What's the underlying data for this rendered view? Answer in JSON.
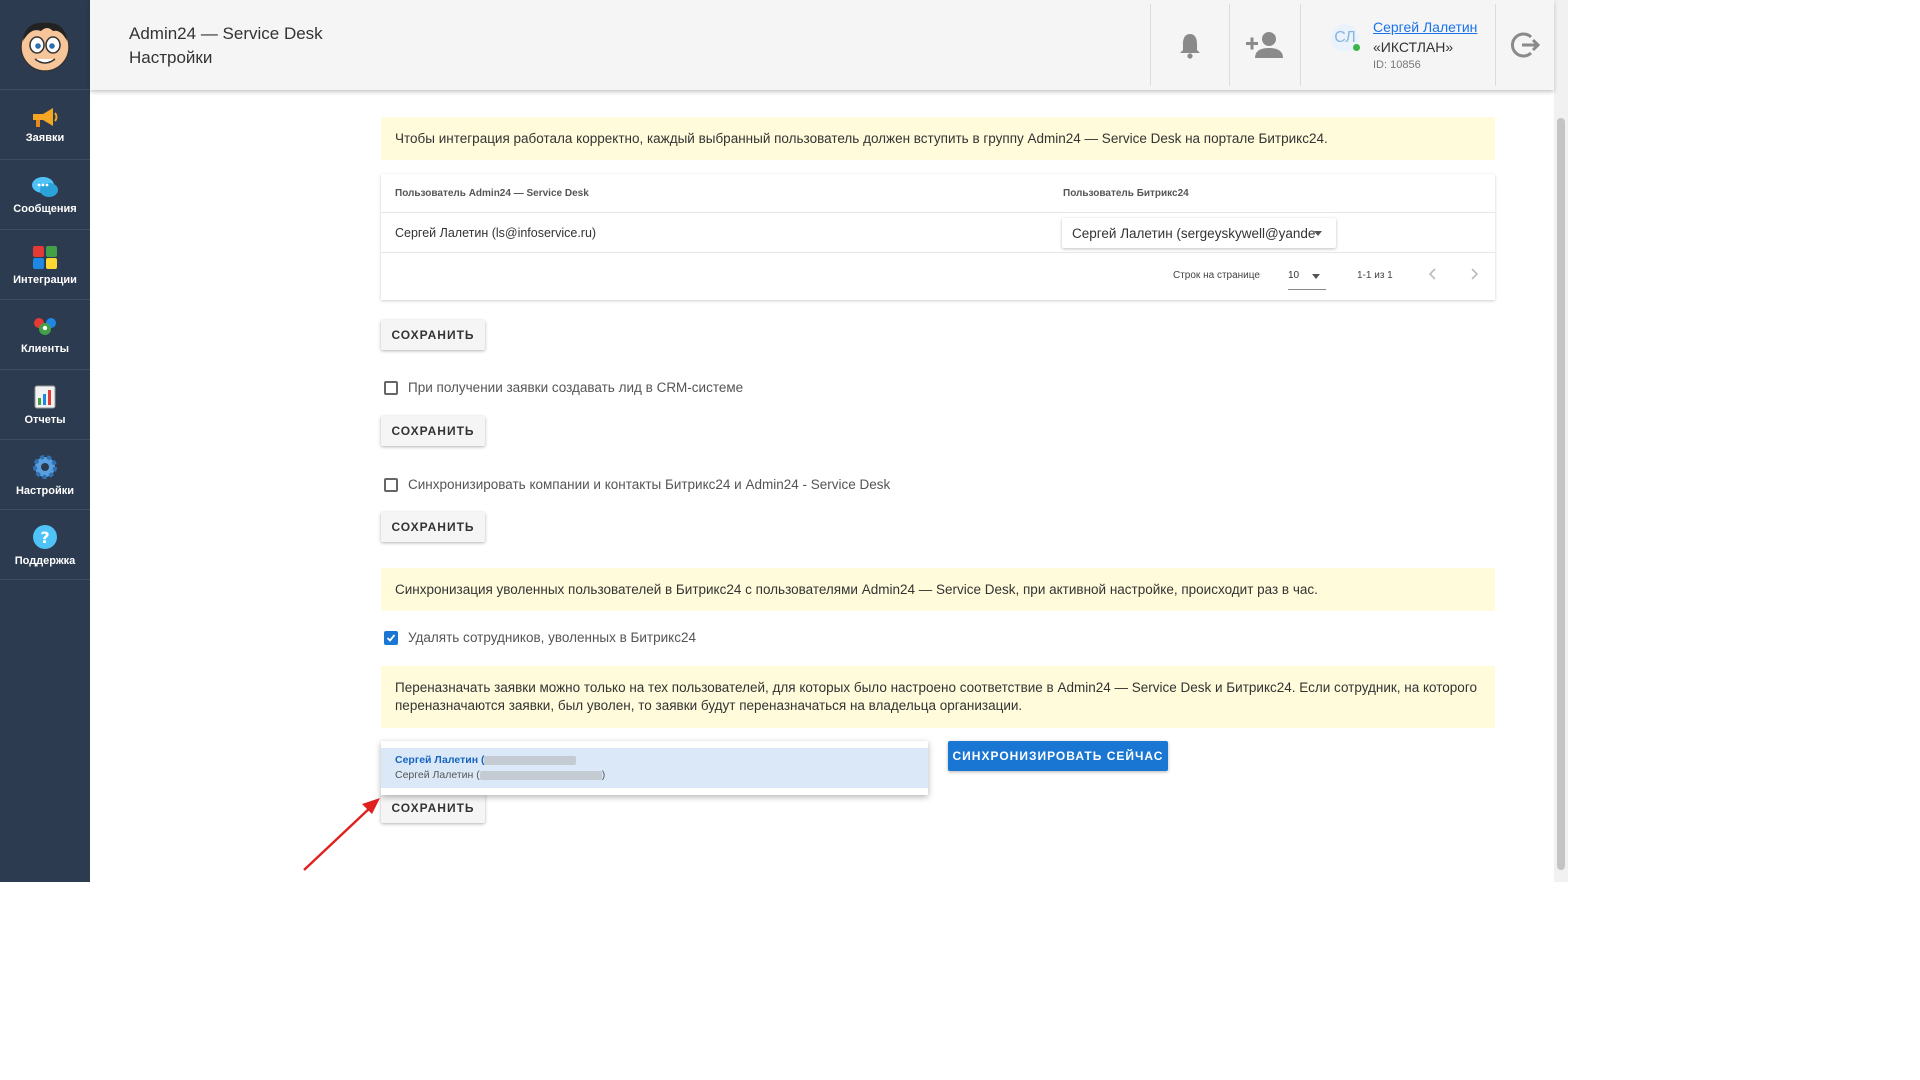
{
  "header": {
    "app_name": "Admin24 — Service Desk",
    "page_name": "Настройки",
    "user": {
      "initials": "СЛ",
      "name": "Сергей Лалетин",
      "org": "«ИКСТЛАН»",
      "id_label": "ID: 10856"
    }
  },
  "sidebar": {
    "items": [
      {
        "label": "Заявки",
        "icon": "megaphone-icon"
      },
      {
        "label": "Сообщения",
        "icon": "chat-bubbles-icon"
      },
      {
        "label": "Интеграции",
        "icon": "puzzle-icon"
      },
      {
        "label": "Клиенты",
        "icon": "people-icon"
      },
      {
        "label": "Отчеты",
        "icon": "report-icon"
      },
      {
        "label": "Настройки",
        "icon": "gear-icon"
      },
      {
        "label": "Поддержка",
        "icon": "question-icon"
      }
    ]
  },
  "main": {
    "note_integration": "Чтобы интеграция работала корректно, каждый выбранный пользователь должен вступить в группу Admin24 — Service Desk на портале Битрикс24.",
    "table": {
      "col_admin": "Пользователь Admin24 — Service Desk",
      "col_bitrix": "Пользователь Битрикс24",
      "rows": [
        {
          "admin_user": "Сергей Лалетин (ls@infoservice.ru)",
          "bitrix_user": "Сергей Лалетин (sergeyskywell@yande"
        }
      ],
      "rows_per_page_label": "Строк на странице",
      "rows_per_page_value": "10",
      "pagination_info": "1-1 из 1"
    },
    "save_label": "СОХРАНИТЬ",
    "checkbox_crm_label": "При получении заявки создавать лид в CRM-системе",
    "checkbox_crm_checked": false,
    "checkbox_sync_label": "Синхронизировать компании и контакты Битрикс24 и Admin24 - Service Desk",
    "checkbox_sync_checked": false,
    "note_fired": "Синхронизация уволенных пользователей в Битрикс24 с пользователями Admin24 — Service Desk, при активной настройке, происходит раз в час.",
    "checkbox_delete_label": "Удалять сотрудников, уволенных в Битрикс24",
    "checkbox_delete_checked": true,
    "note_reassign": "Переназначать заявки можно только на тех пользователей, для которых было настроено соответствие в Admin24 — Service Desk и Битрикс24. Если сотрудник, на которого переназначаются заявки, был уволен, то заявки будут переназначаться на владельца организации.",
    "dropdown": {
      "option1": "Сергей Лалетин (",
      "option2": "Сергей Лалетин (",
      "option2_close": ")"
    },
    "sync_now_label": "СИНХРОНИЗИРОВАТЬ СЕЙЧАС"
  },
  "colors": {
    "sidebar_bg": "#2c3b4f",
    "header_bg": "#f5f5f5",
    "note_bg": "#fffbdb",
    "accent": "#1976d2",
    "annotation_arrow": "#e02020"
  }
}
